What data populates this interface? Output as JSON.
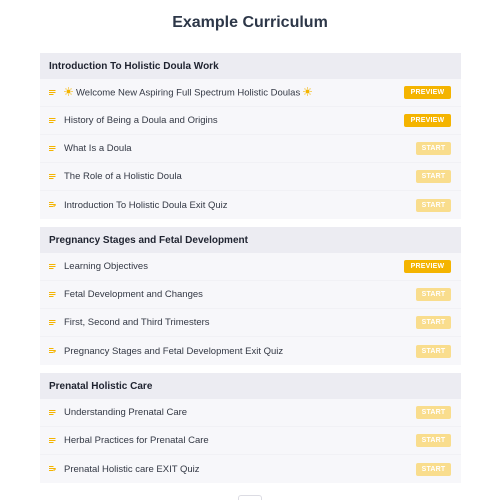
{
  "page": {
    "title": "Example Curriculum"
  },
  "colors": {
    "preview_badge": "#f4b400",
    "start_badge": "#f9dd8d",
    "icon": "#f4b400"
  },
  "sections": [
    {
      "title": "Introduction To Holistic Doula Work",
      "lessons": [
        {
          "title": "Welcome New Aspiring Full Spectrum Holistic Doulas",
          "icon": "lines-icon",
          "decorated": true,
          "action": "PREVIEW",
          "type": "preview"
        },
        {
          "title": "History of Being a Doula and Origins",
          "icon": "lines-icon",
          "action": "PREVIEW",
          "type": "preview"
        },
        {
          "title": "What Is a Doula",
          "icon": "lines-icon",
          "action": "START",
          "type": "start"
        },
        {
          "title": "The Role of a Holistic Doula",
          "icon": "lines-icon",
          "action": "START",
          "type": "start"
        },
        {
          "title": "Introduction To Holistic Doula Exit Quiz",
          "icon": "quiz-icon",
          "action": "START",
          "type": "start"
        }
      ]
    },
    {
      "title": "Pregnancy Stages and Fetal Development",
      "lessons": [
        {
          "title": "Learning Objectives",
          "icon": "lines-icon",
          "action": "PREVIEW",
          "type": "preview"
        },
        {
          "title": "Fetal Development and Changes",
          "icon": "lines-icon",
          "action": "START",
          "type": "start"
        },
        {
          "title": "First, Second and Third Trimesters",
          "icon": "lines-icon",
          "action": "START",
          "type": "start"
        },
        {
          "title": "Pregnancy Stages and Fetal Development Exit Quiz",
          "icon": "quiz-icon",
          "action": "START",
          "type": "start"
        }
      ]
    },
    {
      "title": "Prenatal Holistic Care",
      "lessons": [
        {
          "title": "Understanding Prenatal Care",
          "icon": "lines-icon",
          "action": "START",
          "type": "start"
        },
        {
          "title": "Herbal Practices for Prenatal Care",
          "icon": "lines-icon",
          "action": "START",
          "type": "start"
        },
        {
          "title": "Prenatal Holistic care EXIT Quiz",
          "icon": "quiz-icon",
          "action": "START",
          "type": "start"
        }
      ]
    }
  ]
}
